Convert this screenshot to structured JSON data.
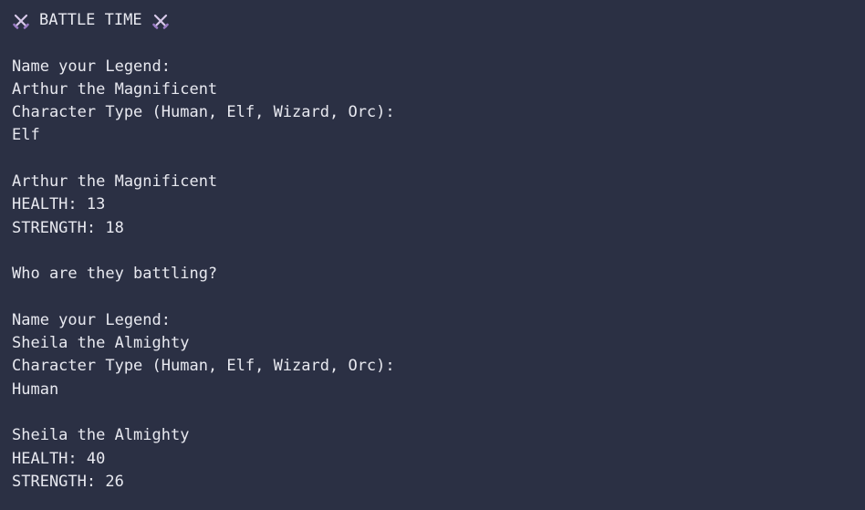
{
  "console": {
    "header": {
      "title": "BATTLE TIME",
      "left_icon": "crossed-swords-icon",
      "right_icon": "crossed-swords-icon"
    },
    "prompts": {
      "name_prompt": "Name your Legend:",
      "type_prompt": "Character Type (Human, Elf, Wizard, Orc):",
      "opponent_prompt": "Who are they battling?"
    },
    "character1": {
      "name_input": "Arthur the Magnificent",
      "type_input": "Elf",
      "summary_name": "Arthur the Magnificent",
      "health": "HEALTH: 13",
      "strength": "STRENGTH: 18"
    },
    "character2": {
      "name_input": "Sheila the Almighty",
      "type_input": "Human",
      "summary_name": "Sheila the Almighty",
      "health": "HEALTH: 40",
      "strength": "STRENGTH: 26"
    }
  }
}
